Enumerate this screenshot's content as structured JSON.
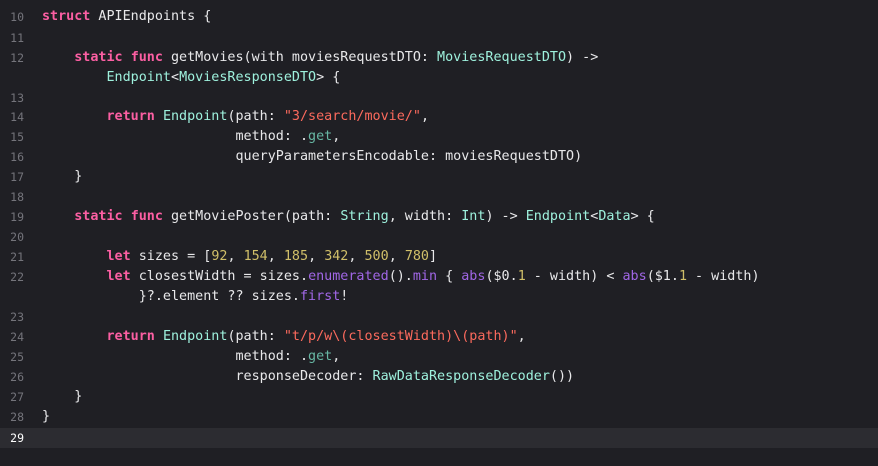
{
  "editor": {
    "language": "swift",
    "current_line": "29",
    "colors": {
      "background": "#1f1f24",
      "current_line_background": "#2c2c31",
      "line_number": "#74747b",
      "keyword": "#fc5fa3",
      "type": "#9ef1dd",
      "function": "#67b7a4",
      "string": "#fc6a5d",
      "number": "#d0bf69",
      "property": "#a167e6",
      "plain": "#e8e8ea"
    },
    "lines": [
      {
        "n": "10",
        "tokens": [
          [
            "kw",
            "struct"
          ],
          [
            "pl",
            " APIEndpoints {"
          ]
        ]
      },
      {
        "n": "11",
        "tokens": []
      },
      {
        "n": "12",
        "tokens": [
          [
            "pl",
            "    "
          ],
          [
            "kw",
            "static"
          ],
          [
            "pl",
            " "
          ],
          [
            "kw",
            "func"
          ],
          [
            "pl",
            " getMovies(with moviesRequestDTO: "
          ],
          [
            "tyc",
            "MoviesRequestDTO"
          ],
          [
            "pl",
            ") ->"
          ]
        ]
      },
      {
        "n": "",
        "tokens": [
          [
            "pl",
            "        "
          ],
          [
            "tyc",
            "Endpoint"
          ],
          [
            "pl",
            "<"
          ],
          [
            "tyc",
            "MoviesResponseDTO"
          ],
          [
            "pl",
            "> {"
          ]
        ]
      },
      {
        "n": "13",
        "tokens": []
      },
      {
        "n": "14",
        "tokens": [
          [
            "pl",
            "        "
          ],
          [
            "kw",
            "return"
          ],
          [
            "pl",
            " "
          ],
          [
            "tyc",
            "Endpoint"
          ],
          [
            "pl",
            "(path: "
          ],
          [
            "str",
            "\"3/search/movie/\""
          ],
          [
            "pl",
            ","
          ]
        ]
      },
      {
        "n": "15",
        "tokens": [
          [
            "pl",
            "                        method: ."
          ],
          [
            "fn",
            "get"
          ],
          [
            "pl",
            ","
          ]
        ]
      },
      {
        "n": "16",
        "tokens": [
          [
            "pl",
            "                        queryParametersEncodable: moviesRequestDTO)"
          ]
        ]
      },
      {
        "n": "17",
        "tokens": [
          [
            "pl",
            "    }"
          ]
        ]
      },
      {
        "n": "18",
        "tokens": []
      },
      {
        "n": "19",
        "tokens": [
          [
            "pl",
            "    "
          ],
          [
            "kw",
            "static"
          ],
          [
            "pl",
            " "
          ],
          [
            "kw",
            "func"
          ],
          [
            "pl",
            " getMoviePoster(path: "
          ],
          [
            "tyc",
            "String"
          ],
          [
            "pl",
            ", width: "
          ],
          [
            "tyc",
            "Int"
          ],
          [
            "pl",
            ") -> "
          ],
          [
            "tyc",
            "Endpoint"
          ],
          [
            "pl",
            "<"
          ],
          [
            "tyc",
            "Data"
          ],
          [
            "pl",
            "> {"
          ]
        ]
      },
      {
        "n": "20",
        "tokens": []
      },
      {
        "n": "21",
        "tokens": [
          [
            "pl",
            "        "
          ],
          [
            "kw",
            "let"
          ],
          [
            "pl",
            " sizes = ["
          ],
          [
            "num",
            "92"
          ],
          [
            "pl",
            ", "
          ],
          [
            "num",
            "154"
          ],
          [
            "pl",
            ", "
          ],
          [
            "num",
            "185"
          ],
          [
            "pl",
            ", "
          ],
          [
            "num",
            "342"
          ],
          [
            "pl",
            ", "
          ],
          [
            "num",
            "500"
          ],
          [
            "pl",
            ", "
          ],
          [
            "num",
            "780"
          ],
          [
            "pl",
            "]"
          ]
        ]
      },
      {
        "n": "22",
        "tokens": [
          [
            "pl",
            "        "
          ],
          [
            "kw",
            "let"
          ],
          [
            "pl",
            " closestWidth = sizes."
          ],
          [
            "prop",
            "enumerated"
          ],
          [
            "pl",
            "()."
          ],
          [
            "prop",
            "min"
          ],
          [
            "pl",
            " { "
          ],
          [
            "prop",
            "abs"
          ],
          [
            "pl",
            "($0."
          ],
          [
            "num",
            "1"
          ],
          [
            "pl",
            " - width) < "
          ],
          [
            "prop",
            "abs"
          ],
          [
            "pl",
            "($1."
          ],
          [
            "num",
            "1"
          ],
          [
            "pl",
            " - width)"
          ]
        ]
      },
      {
        "n": "",
        "tokens": [
          [
            "pl",
            "            }?.element ?? sizes."
          ],
          [
            "prop",
            "first"
          ],
          [
            "pl",
            "!"
          ]
        ]
      },
      {
        "n": "23",
        "tokens": []
      },
      {
        "n": "24",
        "tokens": [
          [
            "pl",
            "        "
          ],
          [
            "kw",
            "return"
          ],
          [
            "pl",
            " "
          ],
          [
            "tyc",
            "Endpoint"
          ],
          [
            "pl",
            "(path: "
          ],
          [
            "str",
            "\"t/p/w\\(closestWidth)\\(path)\""
          ],
          [
            "pl",
            ","
          ]
        ]
      },
      {
        "n": "25",
        "tokens": [
          [
            "pl",
            "                        method: ."
          ],
          [
            "fn",
            "get"
          ],
          [
            "pl",
            ","
          ]
        ]
      },
      {
        "n": "26",
        "tokens": [
          [
            "pl",
            "                        responseDecoder: "
          ],
          [
            "tyc",
            "RawDataResponseDecoder"
          ],
          [
            "pl",
            "())"
          ]
        ]
      },
      {
        "n": "27",
        "tokens": [
          [
            "pl",
            "    }"
          ]
        ]
      },
      {
        "n": "28",
        "tokens": [
          [
            "pl",
            "}"
          ]
        ]
      },
      {
        "n": "29",
        "tokens": []
      }
    ]
  }
}
